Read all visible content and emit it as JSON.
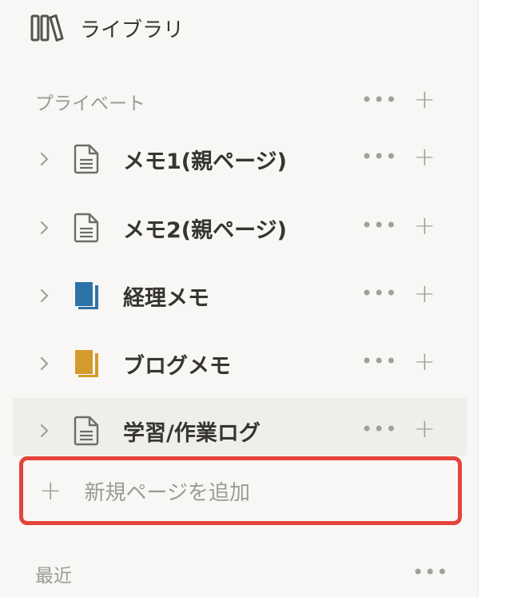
{
  "sidebar": {
    "library": {
      "label": "ライブラリ",
      "icon": "library-books-icon"
    },
    "private_section": {
      "label": "プライベート",
      "more": "•••",
      "add": "+"
    },
    "pages": [
      {
        "title": "メモ1(親ページ)",
        "icon": "document-icon",
        "more": "•••",
        "add": "+"
      },
      {
        "title": "メモ2(親ページ)",
        "icon": "document-icon",
        "more": "•••",
        "add": "+"
      },
      {
        "title": "経理メモ",
        "icon": "blue-notebook-icon",
        "color": "#2e73a8",
        "more": "•••",
        "add": "+"
      },
      {
        "title": "ブログメモ",
        "icon": "yellow-notebook-icon",
        "color": "#d39a2c",
        "more": "•••",
        "add": "+"
      },
      {
        "title": "学習/作業ログ",
        "icon": "document-icon",
        "more": "•••",
        "add": "+"
      }
    ],
    "add_page": {
      "plus": "+",
      "label": "新規ページを追加",
      "highlight_color": "#e5443a"
    },
    "recent_section": {
      "label": "最近",
      "more": "•••"
    }
  }
}
